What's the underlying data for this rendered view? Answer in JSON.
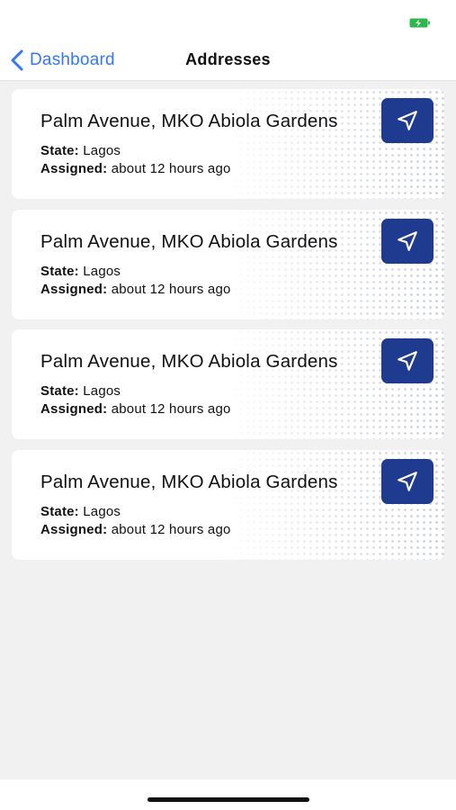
{
  "status_bar": {
    "battery_icon": "battery-charging-icon",
    "battery_color": "#2db84d"
  },
  "nav": {
    "back_label": "Dashboard",
    "title": "Addresses",
    "accent": "#3478f6"
  },
  "addresses": [
    {
      "title": "Palm Avenue, MKO Abiola Gardens",
      "state_key": "State:",
      "state": "Lagos",
      "assigned_key": "Assigned:",
      "assigned": "about 12 hours ago",
      "action_icon": "navigation-arrow-icon"
    },
    {
      "title": "Palm Avenue, MKO Abiola Gardens",
      "state_key": "State:",
      "state": "Lagos",
      "assigned_key": "Assigned:",
      "assigned": "about 12 hours ago",
      "action_icon": "navigation-arrow-icon"
    },
    {
      "title": "Palm Avenue, MKO Abiola Gardens",
      "state_key": "State:",
      "state": "Lagos",
      "assigned_key": "Assigned:",
      "assigned": "about 12 hours ago",
      "action_icon": "navigation-arrow-icon"
    },
    {
      "title": "Palm Avenue, MKO Abiola Gardens",
      "state_key": "State:",
      "state": "Lagos",
      "assigned_key": "Assigned:",
      "assigned": "about 12 hours ago",
      "action_icon": "navigation-arrow-icon"
    }
  ],
  "colors": {
    "button_bg": "#1f3b8f",
    "page_bg": "#f1f1f2"
  }
}
